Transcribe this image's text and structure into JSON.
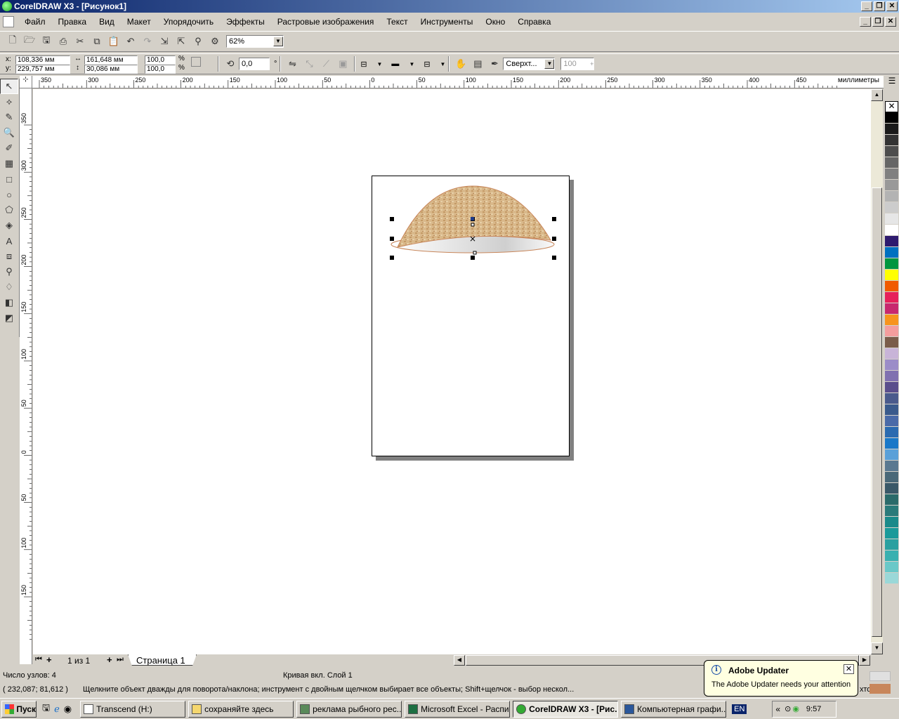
{
  "window": {
    "title": "CorelDRAW X3 - [Рисунок1]"
  },
  "menu": {
    "items": [
      "Файл",
      "Правка",
      "Вид",
      "Макет",
      "Упорядочить",
      "Эффекты",
      "Растровые изображения",
      "Текст",
      "Инструменты",
      "Окно",
      "Справка"
    ]
  },
  "toolbar": {
    "zoom_value": "62%"
  },
  "property_bar": {
    "x_value": "108,336 мм",
    "y_value": "229,757 мм",
    "width_value": "161,648 мм",
    "height_value": "30,086 мм",
    "scale_x": "100,0",
    "scale_y": "100,0",
    "percent_sign": "%",
    "rotation": "0,0",
    "degree_sign": "°",
    "wrap_text": "Сверхт...",
    "opacity": "100"
  },
  "ruler": {
    "unit_label": "миллиметры",
    "h_ticks": [
      "350",
      "300",
      "250",
      "200",
      "150",
      "100",
      "50",
      "0",
      "50",
      "100",
      "150",
      "200",
      "250",
      "300",
      "350",
      "400",
      "450"
    ],
    "v_ticks": [
      "350",
      "300",
      "250",
      "200",
      "150",
      "100",
      "50",
      "0",
      "50",
      "100",
      "150"
    ]
  },
  "pages": {
    "nav_label": "1 из 1",
    "tab_label": "Страница 1"
  },
  "status": {
    "nodes": "Число узлов: 4",
    "object_info": "Кривая вкл. Слой 1",
    "coords": "( 232,087; 81,612 )",
    "hint": "Щелкните объект дважды для поворота/наклона; инструмент с двойным щелчком выбирает все объекты; Shift+щелчок - выбор нескол...",
    "hint_tail": "хто...а."
  },
  "notification": {
    "title": "Adobe Updater",
    "message": "The Adobe Updater needs your attention"
  },
  "taskbar": {
    "start_label": "Пуск",
    "tasks": [
      "Transcend (H:)",
      "сохраняйте здесь",
      "реклама рыбного рес...",
      "Microsoft Excel - Распи...",
      "CorelDRAW X3 - [Рис...",
      "Компьютерная графи..."
    ],
    "lang": "EN",
    "clock": "9:57",
    "expand": "«"
  },
  "colors": {
    "palette": [
      "#000000",
      "#1a1a1a",
      "#333333",
      "#4d4d4d",
      "#666666",
      "#808080",
      "#999999",
      "#b3b3b3",
      "#cccccc",
      "#e6e6e6",
      "#ffffff",
      "#2e1a6e",
      "#0070c0",
      "#00963f",
      "#ffff00",
      "#f05a00",
      "#e6205a",
      "#c8286e",
      "#f7941d",
      "#f49d9d",
      "#7a5c4a",
      "#c8b4d8",
      "#9b8cc8",
      "#8071b0",
      "#5a4e8c",
      "#4a5a8c",
      "#3a5a8c",
      "#4a6aa8",
      "#2a6ab0",
      "#1a78c8",
      "#5aa0d8",
      "#5a7890",
      "#4a6878",
      "#3a5868",
      "#2a6a6a",
      "#2a7a7a",
      "#1a8a8a",
      "#1a9a9a",
      "#2aa0a0",
      "#3ab0b0",
      "#6ac8c8",
      "#9ad8d8"
    ],
    "accent": "#0a246a"
  }
}
